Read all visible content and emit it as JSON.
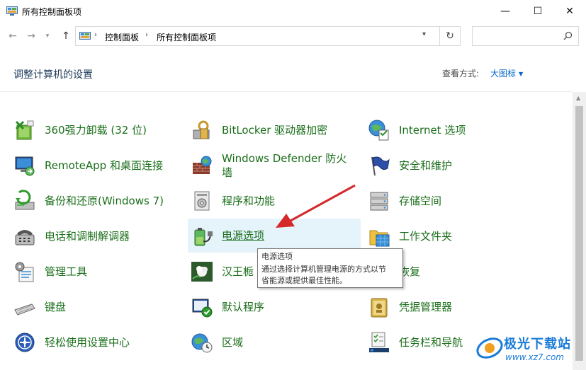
{
  "window": {
    "title": "所有控制面板项",
    "min_glyph": "—",
    "max_glyph": "☐",
    "close_glyph": "✕"
  },
  "nav": {
    "back_glyph": "←",
    "forward_glyph": "→",
    "history_glyph": "▾",
    "up_glyph": "↑",
    "refresh_glyph": "↻",
    "breadcrumbs": [
      "控制面板",
      "所有控制面板项"
    ],
    "crumb_sep": "›",
    "dropdown_glyph": "▾",
    "search_value": "",
    "search_placeholder": ""
  },
  "header": {
    "title": "调整计算机的设置",
    "view_by_label": "查看方式:",
    "view_by_value": "大图标",
    "view_caret": "▼"
  },
  "items": [
    {
      "label": "360强力卸载 (32 位)",
      "icon": "uninstall-icon"
    },
    {
      "label": "BitLocker 驱动器加密",
      "icon": "bitlocker-icon"
    },
    {
      "label": "Internet 选项",
      "icon": "internet-options-icon"
    },
    {
      "label": "RemoteApp 和桌面连接",
      "icon": "remoteapp-icon"
    },
    {
      "label": "Windows Defender 防火墙",
      "label_line1": "Windows Defender 防火",
      "label_line2": "墙",
      "icon": "firewall-icon"
    },
    {
      "label": "安全和维护",
      "icon": "security-flag-icon"
    },
    {
      "label": "备份和还原(Windows 7)",
      "icon": "backup-icon"
    },
    {
      "label": "程序和功能",
      "icon": "programs-icon"
    },
    {
      "label": "存储空间",
      "icon": "storage-icon"
    },
    {
      "label": "电话和调制解调器",
      "icon": "phone-modem-icon"
    },
    {
      "label": "电源选项",
      "icon": "power-options-icon"
    },
    {
      "label": "工作文件夹",
      "icon": "work-folders-icon"
    },
    {
      "label": "管理工具",
      "icon": "admin-tools-icon"
    },
    {
      "label": "汉王栀",
      "icon": "hanwang-icon"
    },
    {
      "label": "恢复",
      "icon": "recovery-icon"
    },
    {
      "label": "键盘",
      "icon": "keyboard-icon"
    },
    {
      "label": "默认程序",
      "icon": "default-programs-icon"
    },
    {
      "label": "凭据管理器",
      "icon": "credential-manager-icon"
    },
    {
      "label": "轻松使用设置中心",
      "icon": "ease-of-access-icon"
    },
    {
      "label": "区域",
      "icon": "region-icon"
    },
    {
      "label": "任务栏和导航",
      "icon": "taskbar-icon"
    }
  ],
  "tooltip": {
    "title": "电源选项",
    "line1": "通过选择计算机管理电源的方式以节",
    "line2": "省能源或提供最佳性能。"
  },
  "watermark": {
    "text": "极光下载站",
    "url": "www.xz7.com"
  },
  "colors": {
    "link_green": "#1a6e1a",
    "link_blue": "#0066cc",
    "hover_bg": "#e5f3fb",
    "arrow_red": "#d42a2a"
  }
}
